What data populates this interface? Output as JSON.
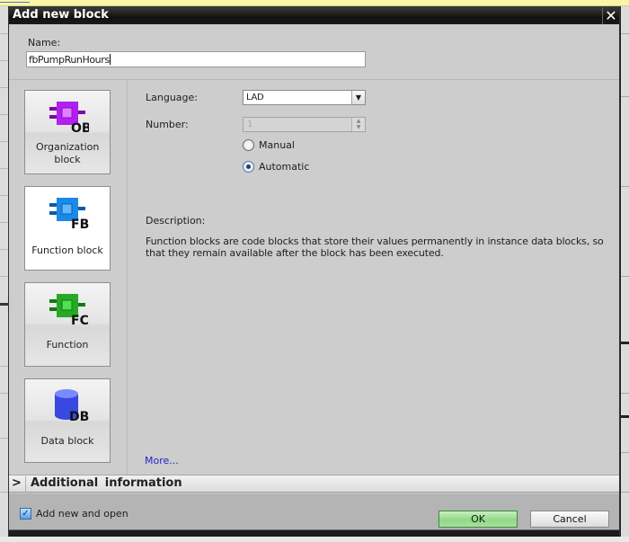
{
  "dialog": {
    "title": "Add new block",
    "close_icon": "close-icon"
  },
  "name": {
    "label": "Name:",
    "value": "fbPumpRunHours"
  },
  "block_types": [
    {
      "id": "ob",
      "tag": "OB",
      "label": "Organization block",
      "icon": "organization-block-icon",
      "color": "#a010e0",
      "selected": false
    },
    {
      "id": "fb",
      "tag": "FB",
      "label": "Function block",
      "icon": "function-block-icon",
      "color": "#1a8ae8",
      "selected": true
    },
    {
      "id": "fc",
      "tag": "FC",
      "label": "Function",
      "icon": "function-icon",
      "color": "#28b028",
      "selected": false
    },
    {
      "id": "db",
      "tag": "DB",
      "label": "Data block",
      "icon": "data-block-icon",
      "color": "#4a5ae8",
      "selected": false
    }
  ],
  "settings": {
    "language_label": "Language:",
    "language_value": "LAD",
    "number_label": "Number:",
    "number_value": "1",
    "number_mode_options": [
      {
        "label": "Manual",
        "checked": false
      },
      {
        "label": "Automatic",
        "checked": true
      }
    ]
  },
  "description": {
    "title": "Description:",
    "text": "Function blocks are code blocks that store their values permanently in instance data blocks, so that they remain available after the block has been executed.",
    "more_link": "More..."
  },
  "additional_info": {
    "chevron": ">",
    "label": "Additional information"
  },
  "footer": {
    "add_new_and_open_label": "Add new and open",
    "add_new_and_open_checked": true,
    "ok_label": "OK",
    "cancel_label": "Cancel"
  },
  "colors": {
    "titlebar": "#111111",
    "dialog_bg": "#cdcdcd",
    "ok_button": "#92d888",
    "link": "#2222cc"
  }
}
